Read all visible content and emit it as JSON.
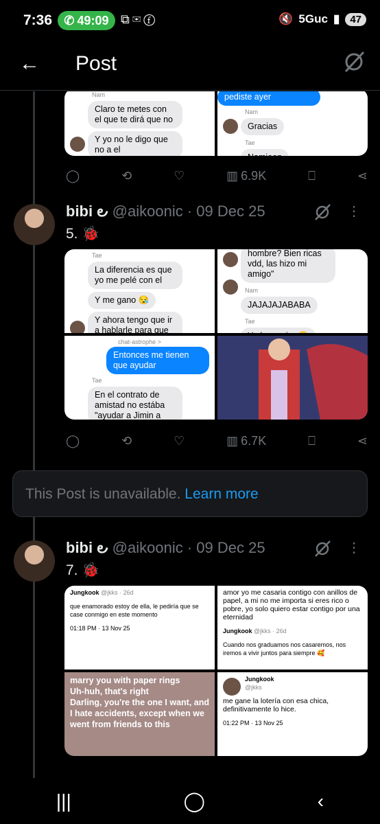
{
  "status": {
    "time": "7:36",
    "call": "49:09",
    "network": "5Guc",
    "battery": "47"
  },
  "header": {
    "title": "Post"
  },
  "post_a": {
    "grid": {
      "c1": {
        "name": "Nam",
        "b1": "Claro te metes con el que te dirá que no",
        "b2": "Y yo no le digo que no a el"
      },
      "c2": {
        "blue": "pediste ayer",
        "name1": "Nam",
        "b1": "Gracias",
        "name2": "Tae",
        "b2": "Namjoon"
      }
    },
    "views": "6.9K"
  },
  "post5": {
    "name": "bibi ౿",
    "handle": "@aikoonic",
    "date": "· 09 Dec 25",
    "text": "5. 🐞",
    "grid": {
      "c1": {
        "name": "Tae",
        "b1": "La diferencia es que yo me pelé con el",
        "b2": "Y me gano 😪",
        "b3": "Y ahora tengo que ir a hablarle para que Jimin se ponga feliz"
      },
      "c2": {
        "b0": "hombre? Bien ricas vdd, las hizo mi amigo\"",
        "name1": "Nam",
        "b1": "JAJAJAJABABA",
        "name2": "Tae",
        "b2": "Y el me mira 😑"
      },
      "c3": {
        "header": "chat-astrophe >",
        "blue": "Entonces me tienen que ayudar",
        "name": "Tae",
        "b1": "En el contrato de amistad no estába \"ayudar a Jimin a"
      }
    },
    "views": "6.7K"
  },
  "unavailable": {
    "text": "This Post is unavailable.",
    "link": "Learn more"
  },
  "post7": {
    "name": "bibi ౿",
    "handle": "@aikoonic",
    "date": "· 09 Dec 25",
    "text": "7. 🐞",
    "grid": {
      "c1": {
        "user": "Jungkook",
        "h": "@jkks · 26d",
        "text": "que enamorado estoy de ella, le pediría que se case conmigo en este momento",
        "time": "01:18 PM · 13 Nov 25"
      },
      "c2": {
        "text0": "amor yo me casaria contigo con anillos de papel, a mi no me importa si eres rico o pobre, yo solo quiero estar contigo por una eternidad",
        "user": "Jungkook",
        "h": "@jkks · 26d",
        "text": "Cuando nos graduamos nos casaremos, nos iremos a vivir juntos para siempre 🥰"
      },
      "c3": {
        "l1": "marry you with paper rings",
        "l2": "Uh-huh, that's right",
        "l3": "Darling, you're the one I want, and",
        "l4": "I hate accidents, except when we went from friends to this"
      },
      "c4": {
        "user": "Jungkook",
        "h": "@jkks",
        "text": "me gane la lotería con esa chica, definitivamente lo hice.",
        "time": "01:22 PM · 13 Nov 25"
      }
    }
  }
}
